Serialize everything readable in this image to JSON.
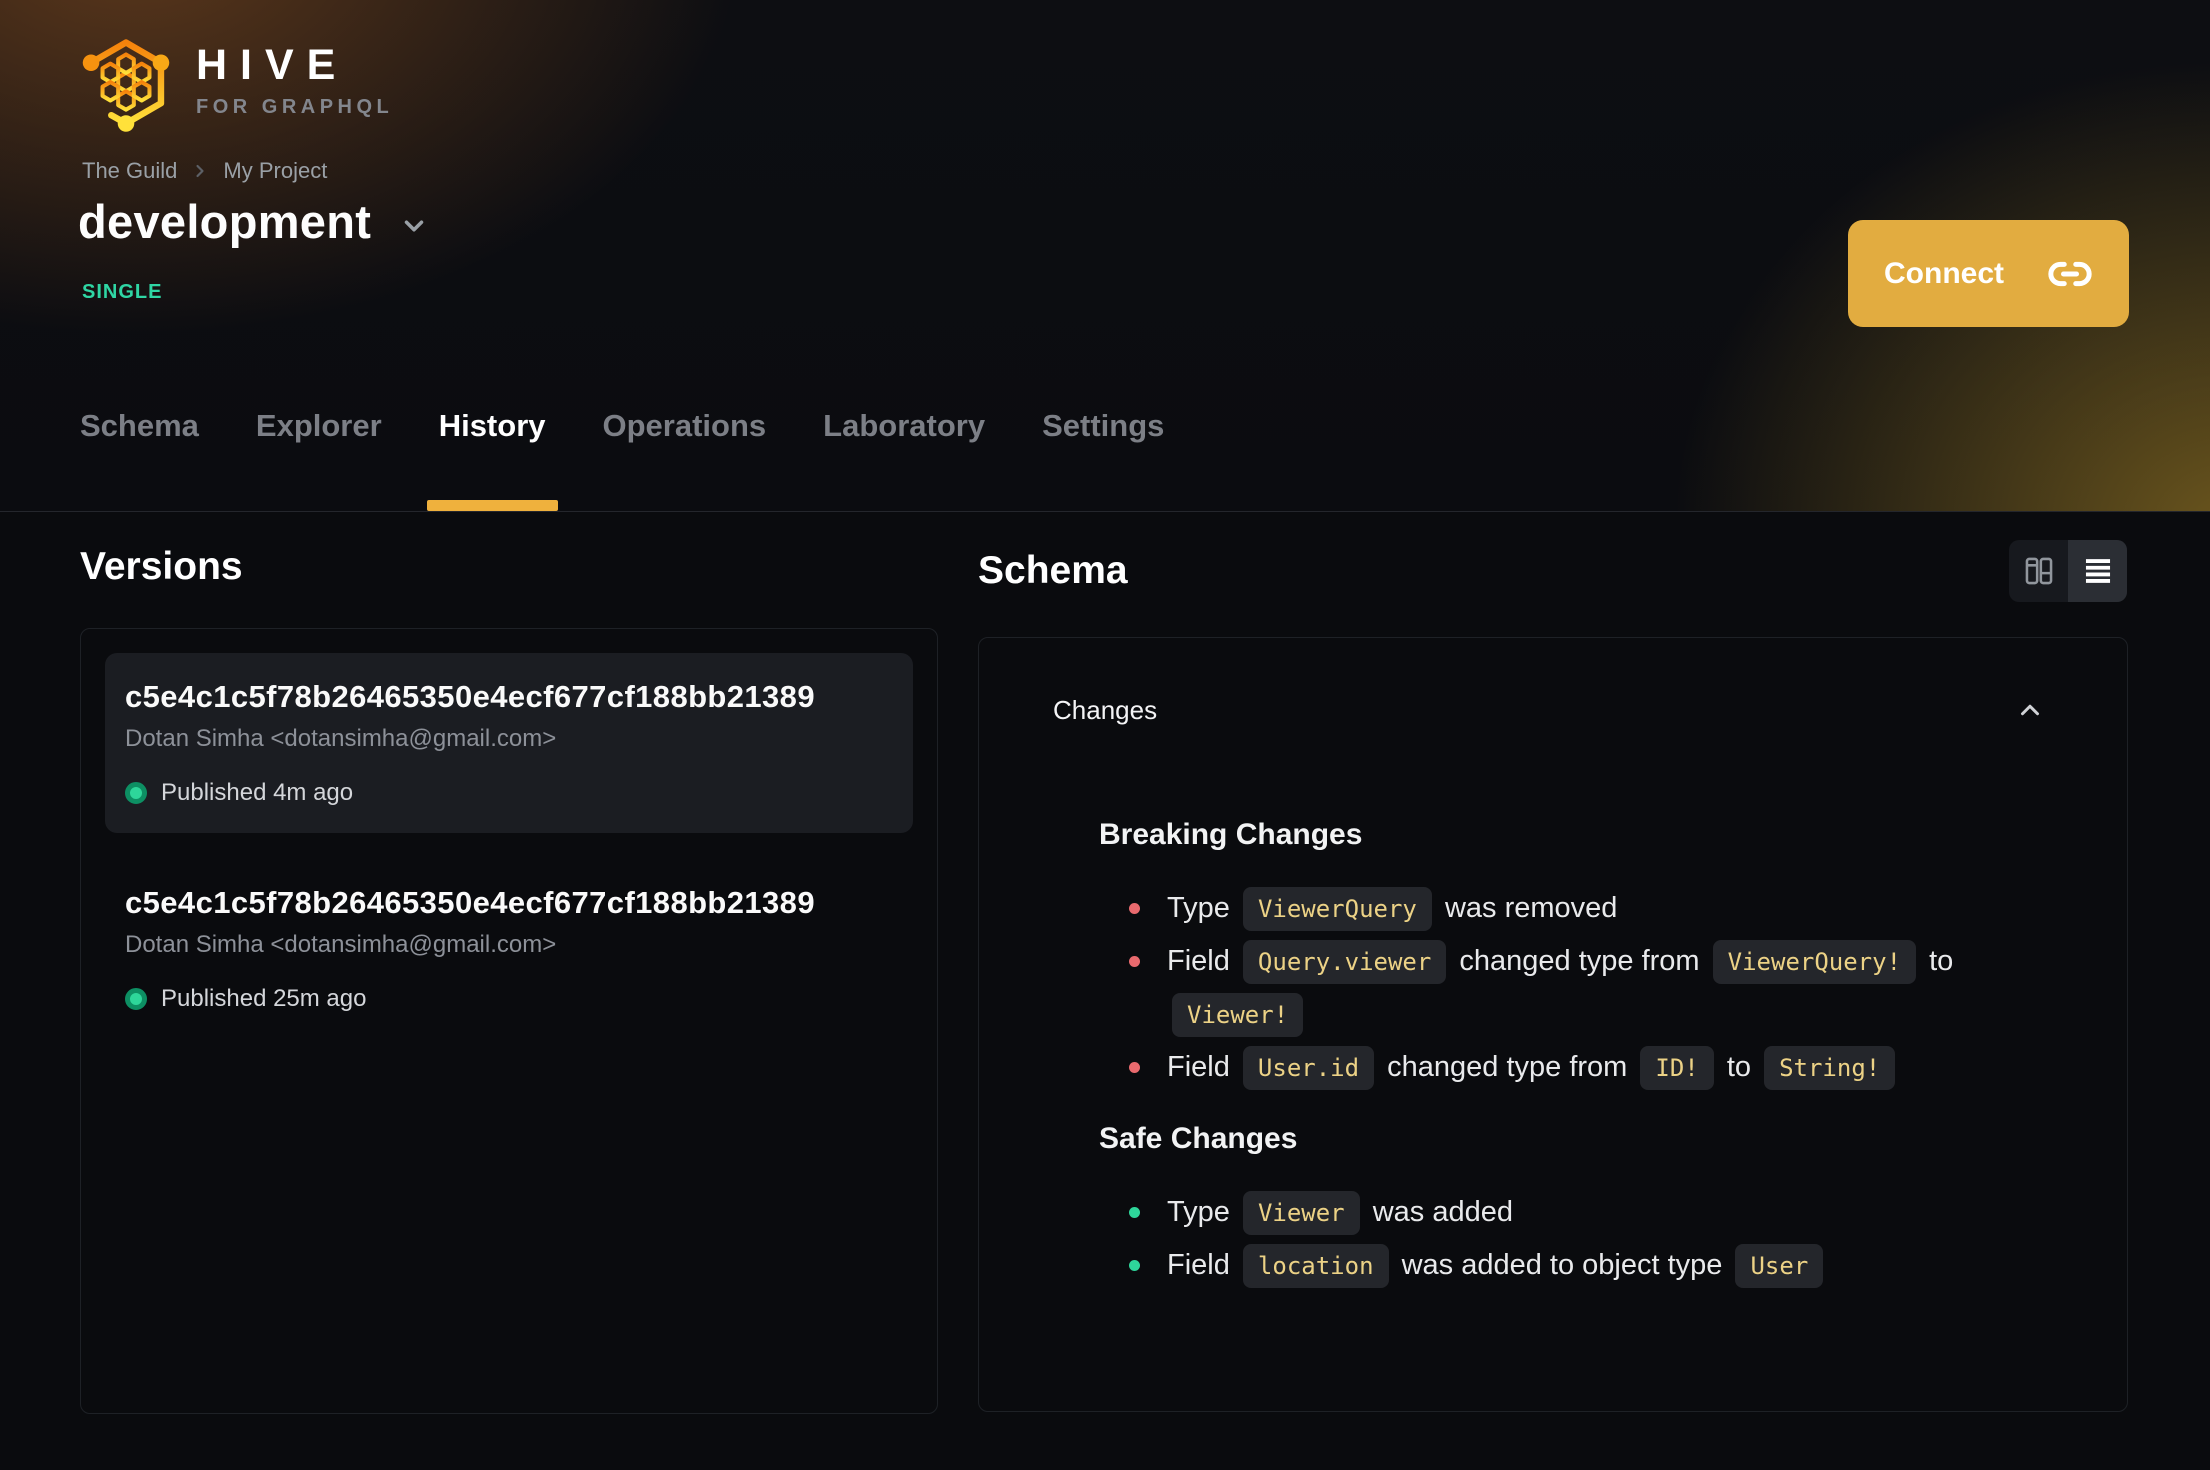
{
  "brand": {
    "name": "HIVE",
    "tagline": "FOR GRAPHQL"
  },
  "breadcrumb": {
    "items": [
      "The Guild",
      "My Project"
    ]
  },
  "target": {
    "name": "development",
    "badge": "SINGLE"
  },
  "connect": {
    "label": "Connect",
    "icon": "link-icon"
  },
  "tabs": [
    {
      "label": "Schema",
      "active": false
    },
    {
      "label": "Explorer",
      "active": false
    },
    {
      "label": "History",
      "active": true
    },
    {
      "label": "Operations",
      "active": false
    },
    {
      "label": "Laboratory",
      "active": false
    },
    {
      "label": "Settings",
      "active": false
    }
  ],
  "versions": {
    "title": "Versions",
    "items": [
      {
        "hash": "c5e4c1c5f78b26465350e4ecf677cf188bb21389",
        "author": "Dotan Simha <dotansimha@gmail.com>",
        "status": "Published 4m ago",
        "selected": true
      },
      {
        "hash": "c5e4c1c5f78b26465350e4ecf677cf188bb21389",
        "author": "Dotan Simha <dotansimha@gmail.com>",
        "status": "Published 25m ago",
        "selected": false
      }
    ]
  },
  "schema": {
    "title": "Schema",
    "view_toggle": {
      "options": [
        "columns-view",
        "list-view"
      ],
      "active": "list-view"
    },
    "changes": {
      "label": "Changes",
      "collapsed": false,
      "groups": [
        {
          "kind": "breaking",
          "title": "Breaking Changes",
          "items": [
            [
              {
                "t": "text",
                "v": "Type"
              },
              {
                "t": "code",
                "v": "ViewerQuery"
              },
              {
                "t": "text",
                "v": "was removed"
              }
            ],
            [
              {
                "t": "text",
                "v": "Field"
              },
              {
                "t": "code",
                "v": "Query.viewer"
              },
              {
                "t": "text",
                "v": "changed type from"
              },
              {
                "t": "code",
                "v": "ViewerQuery!"
              },
              {
                "t": "text",
                "v": "to"
              },
              {
                "t": "code",
                "v": "Viewer!"
              }
            ],
            [
              {
                "t": "text",
                "v": "Field"
              },
              {
                "t": "code",
                "v": "User.id"
              },
              {
                "t": "text",
                "v": "changed type from"
              },
              {
                "t": "code",
                "v": "ID!"
              },
              {
                "t": "text",
                "v": "to"
              },
              {
                "t": "code",
                "v": "String!"
              }
            ]
          ]
        },
        {
          "kind": "safe",
          "title": "Safe Changes",
          "items": [
            [
              {
                "t": "text",
                "v": "Type"
              },
              {
                "t": "code",
                "v": "Viewer"
              },
              {
                "t": "text",
                "v": "was added"
              }
            ],
            [
              {
                "t": "text",
                "v": "Field"
              },
              {
                "t": "code",
                "v": "location"
              },
              {
                "t": "text",
                "v": "was added to object type"
              },
              {
                "t": "code",
                "v": "User"
              }
            ]
          ]
        }
      ]
    }
  },
  "theme": {
    "accent": "#EFB13D",
    "connect_bg": "#E2AC40",
    "single": "#2FD6A4",
    "breaking": "#E96A6E",
    "safe": "#2ED69A",
    "dot": "#2ED69A",
    "code": "#ECD286"
  }
}
